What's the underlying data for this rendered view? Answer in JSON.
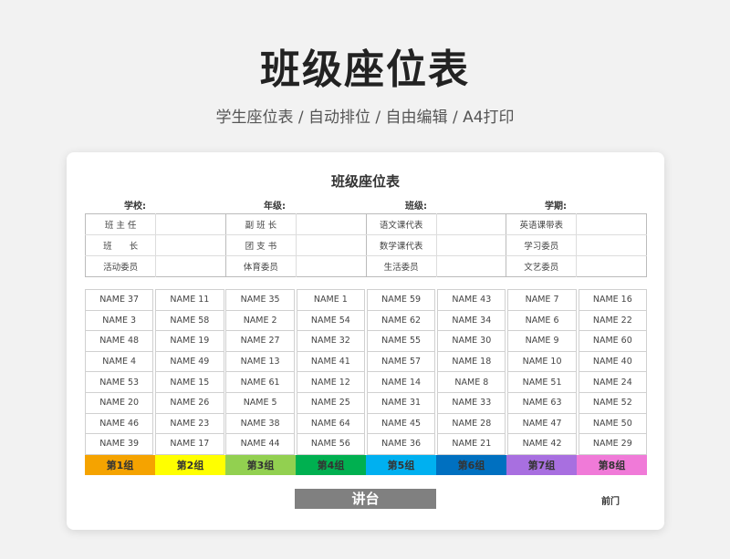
{
  "header": {
    "title": "班级座位表",
    "subtitle": "学生座位表 / 自动排位 / 自由编辑 / A4打印"
  },
  "sheet": {
    "title": "班级座位表",
    "meta": [
      "学校:",
      "年级:",
      "班级:",
      "学期:"
    ],
    "roles": [
      [
        "班 主 任",
        "",
        "副 班 长",
        "",
        "语文课代表",
        "",
        "英语课带表",
        ""
      ],
      [
        "班　　长",
        "",
        "团 支 书",
        "",
        "数学课代表",
        "",
        "学习委员",
        ""
      ],
      [
        "活动委员",
        "",
        "体育委员",
        "",
        "生活委员",
        "",
        "文艺委员",
        ""
      ]
    ],
    "seats": [
      [
        "NAME 37",
        "NAME 11",
        "NAME 35",
        "NAME 1",
        "NAME 59",
        "NAME 43",
        "NAME 7",
        "NAME 16"
      ],
      [
        "NAME 3",
        "NAME 58",
        "NAME 2",
        "NAME 54",
        "NAME 62",
        "NAME 34",
        "NAME 6",
        "NAME 22"
      ],
      [
        "NAME 48",
        "NAME 19",
        "NAME 27",
        "NAME 32",
        "NAME 55",
        "NAME 30",
        "NAME 9",
        "NAME 60"
      ],
      [
        "NAME 4",
        "NAME 49",
        "NAME 13",
        "NAME 41",
        "NAME 57",
        "NAME 18",
        "NAME 10",
        "NAME 40"
      ],
      [
        "NAME 53",
        "NAME 15",
        "NAME 61",
        "NAME 12",
        "NAME 14",
        "NAME 8",
        "NAME 51",
        "NAME 24"
      ],
      [
        "NAME 20",
        "NAME 26",
        "NAME 5",
        "NAME 25",
        "NAME 31",
        "NAME 33",
        "NAME 63",
        "NAME 52"
      ],
      [
        "NAME 46",
        "NAME 23",
        "NAME 38",
        "NAME 64",
        "NAME 45",
        "NAME 28",
        "NAME 47",
        "NAME 50"
      ],
      [
        "NAME 39",
        "NAME 17",
        "NAME 44",
        "NAME 56",
        "NAME 36",
        "NAME 21",
        "NAME 42",
        "NAME 29"
      ]
    ],
    "groups": [
      {
        "label": "第1组",
        "color": "#f5a300"
      },
      {
        "label": "第2组",
        "color": "#ffff00"
      },
      {
        "label": "第3组",
        "color": "#92d050"
      },
      {
        "label": "第4组",
        "color": "#00b050"
      },
      {
        "label": "第5组",
        "color": "#00b0f0"
      },
      {
        "label": "第6组",
        "color": "#0070c0"
      },
      {
        "label": "第7组",
        "color": "#a86fe0"
      },
      {
        "label": "第8组",
        "color": "#f07ad8"
      }
    ],
    "podium": "讲台",
    "door": "前门"
  }
}
